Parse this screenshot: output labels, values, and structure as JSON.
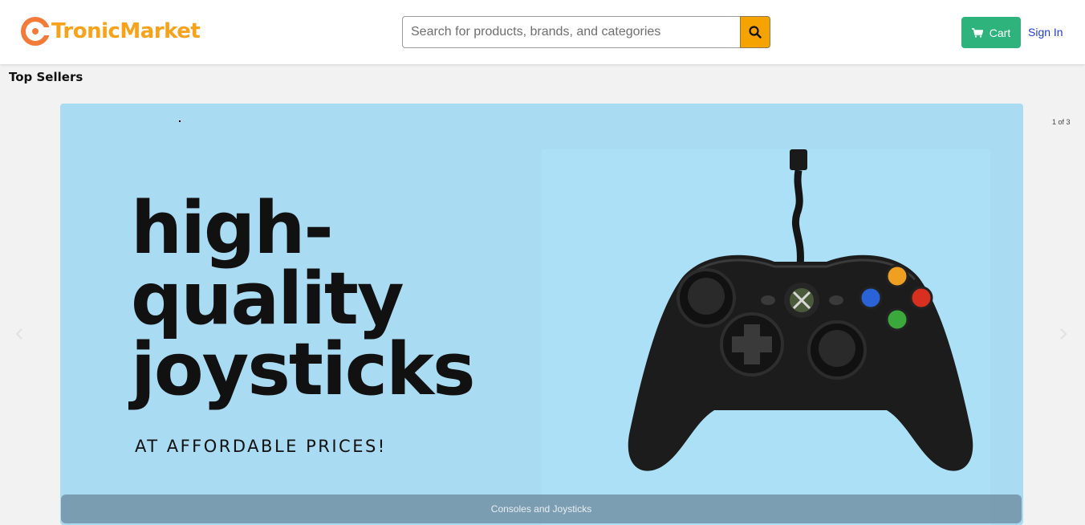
{
  "brand": {
    "name": "TronicMarket",
    "color": "#f7a21b"
  },
  "search": {
    "placeholder": "Search for products, brands, and categories",
    "button_icon": "search-icon"
  },
  "header": {
    "cart_label": "Cart",
    "cart_icon": "cart-icon",
    "signin_label": "Sign In"
  },
  "section": {
    "title": "Top Sellers"
  },
  "carousel": {
    "counter": "1 of 3",
    "slide": {
      "headline_lines": [
        "high-",
        "quality",
        "joysticks"
      ],
      "subline": "AT AFFORDABLE PRICES!",
      "caption": "Consoles and Joysticks",
      "image": "game-controller-image",
      "background": "#a9dbf2"
    },
    "prev_icon": "chevron-left-icon",
    "next_icon": "chevron-right-icon"
  },
  "colors": {
    "accent": "#f5a300",
    "cart_green": "#2fb37d",
    "link_blue": "#1f3fcf"
  }
}
